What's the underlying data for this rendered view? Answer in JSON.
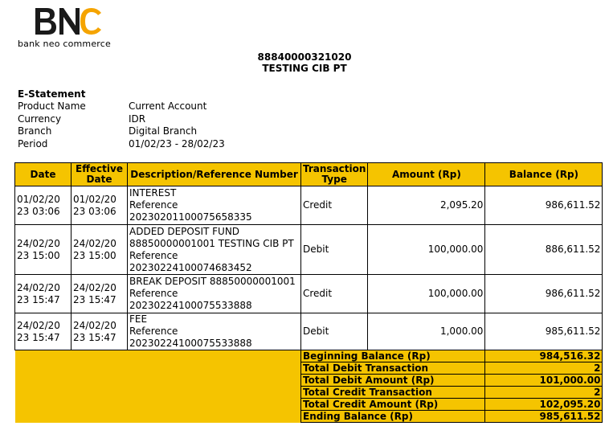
{
  "logo": {
    "mark": "BNC",
    "text": "bank neo commerce"
  },
  "account": {
    "number": "88840000321020",
    "name": "TESTING CIB PT"
  },
  "info": {
    "title": "E-Statement",
    "rows": [
      {
        "label": "Product Name",
        "value": "Current Account"
      },
      {
        "label": "Currency",
        "value": "IDR"
      },
      {
        "label": "Branch",
        "value": "Digital Branch"
      },
      {
        "label": "Period",
        "value": "01/02/23 - 28/02/23"
      }
    ]
  },
  "table": {
    "headers": [
      "Date",
      "Effective Date",
      "Description/Reference Number",
      "Transaction Type",
      "Amount (Rp)",
      "Balance (Rp)"
    ],
    "rows": [
      {
        "date": "01/02/20\n23 03:06",
        "eff": "01/02/20\n23 03:06",
        "desc": "INTEREST\nReference\n20230201100075658335",
        "type": "Credit",
        "amount": "2,095.20",
        "balance": "986,611.52"
      },
      {
        "date": "24/02/20\n23 15:00",
        "eff": "24/02/20\n23 15:00",
        "desc": "ADDED DEPOSIT FUND\n88850000001001 TESTING CIB PT\nReference\n20230224100074683452",
        "type": "Debit",
        "amount": "100,000.00",
        "balance": "886,611.52"
      },
      {
        "date": "24/02/20\n23 15:47",
        "eff": "24/02/20\n23 15:47",
        "desc": "BREAK DEPOSIT 88850000001001\nReference\n20230224100075533888",
        "type": "Credit",
        "amount": "100,000.00",
        "balance": "986,611.52"
      },
      {
        "date": "24/02/20\n23 15:47",
        "eff": "24/02/20\n23 15:47",
        "desc": "FEE\nReference\n20230224100075533888",
        "type": "Debit",
        "amount": "1,000.00",
        "balance": "985,611.52"
      }
    ],
    "summary": [
      {
        "label": "Beginning Balance (Rp)",
        "value": "984,516.32"
      },
      {
        "label": "Total Debit Transaction",
        "value": "2"
      },
      {
        "label": "Total Debit Amount (Rp)",
        "value": "101,000.00"
      },
      {
        "label": "Total Credit Transaction",
        "value": "2"
      },
      {
        "label": "Total Credit Amount (Rp)",
        "value": "102,095.20"
      },
      {
        "label": "Ending Balance (Rp)",
        "value": "985,611.52"
      }
    ]
  },
  "colors": {
    "header_bg": "#f5c400"
  }
}
